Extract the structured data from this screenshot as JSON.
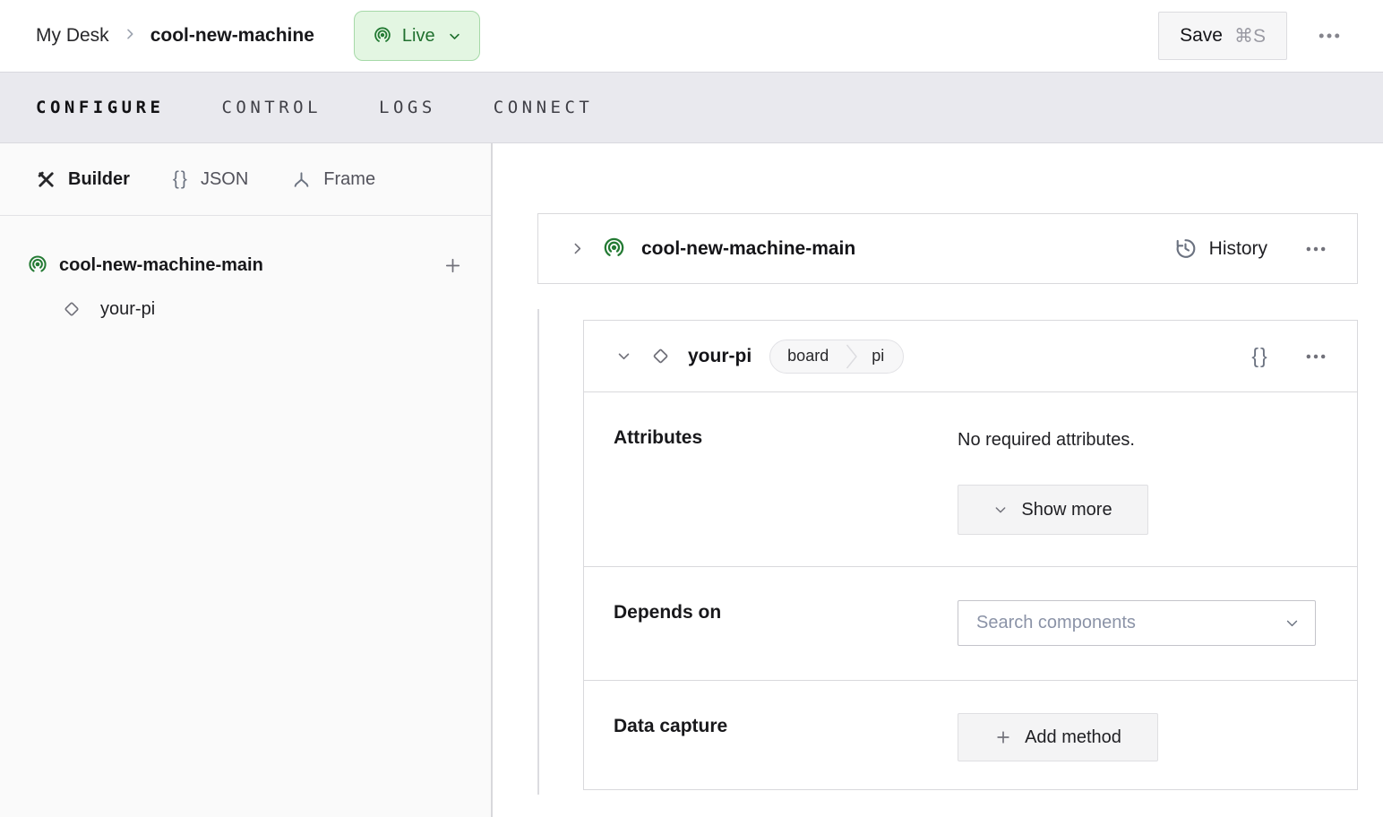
{
  "header": {
    "breadcrumb": {
      "parent": "My Desk",
      "current": "cool-new-machine"
    },
    "status_badge": {
      "label": "Live"
    },
    "save_button": {
      "label": "Save",
      "shortcut": "⌘S"
    }
  },
  "tabs": [
    {
      "label": "CONFIGURE",
      "active": true
    },
    {
      "label": "CONTROL",
      "active": false
    },
    {
      "label": "LOGS",
      "active": false
    },
    {
      "label": "CONNECT",
      "active": false
    }
  ],
  "sidebar": {
    "view_tabs": [
      {
        "label": "Builder",
        "icon": "tools-icon",
        "active": true
      },
      {
        "label": "JSON",
        "icon": "braces-icon",
        "active": false
      },
      {
        "label": "Frame",
        "icon": "frame-axes-icon",
        "active": false
      }
    ],
    "tree": {
      "root": {
        "label": "cool-new-machine-main",
        "icon": "machine-live-icon"
      },
      "children": [
        {
          "label": "your-pi",
          "icon": "component-diamond-icon"
        }
      ]
    }
  },
  "main": {
    "machine_card": {
      "title": "cool-new-machine-main",
      "history_label": "History"
    },
    "component_card": {
      "title": "your-pi",
      "type_badge": {
        "type": "board",
        "model": "pi"
      },
      "attributes": {
        "label": "Attributes",
        "empty_text": "No required attributes.",
        "show_more_label": "Show more"
      },
      "depends_on": {
        "label": "Depends on",
        "search_placeholder": "Search components"
      },
      "data_capture": {
        "label": "Data capture",
        "add_method_label": "Add method"
      }
    }
  },
  "icons": {
    "braces_glyph": "{}"
  },
  "colors": {
    "accent_green": "#237a33",
    "live_badge_bg": "#e3f6e2",
    "live_badge_border": "#a6d9a8",
    "live_badge_text": "#20702e",
    "tabbar_bg": "#e9e9ee",
    "sidebar_bg": "#fafafa",
    "card_border": "#d9d9dc",
    "button_bg": "#f4f4f5",
    "placeholder_text": "#8b93a7"
  }
}
